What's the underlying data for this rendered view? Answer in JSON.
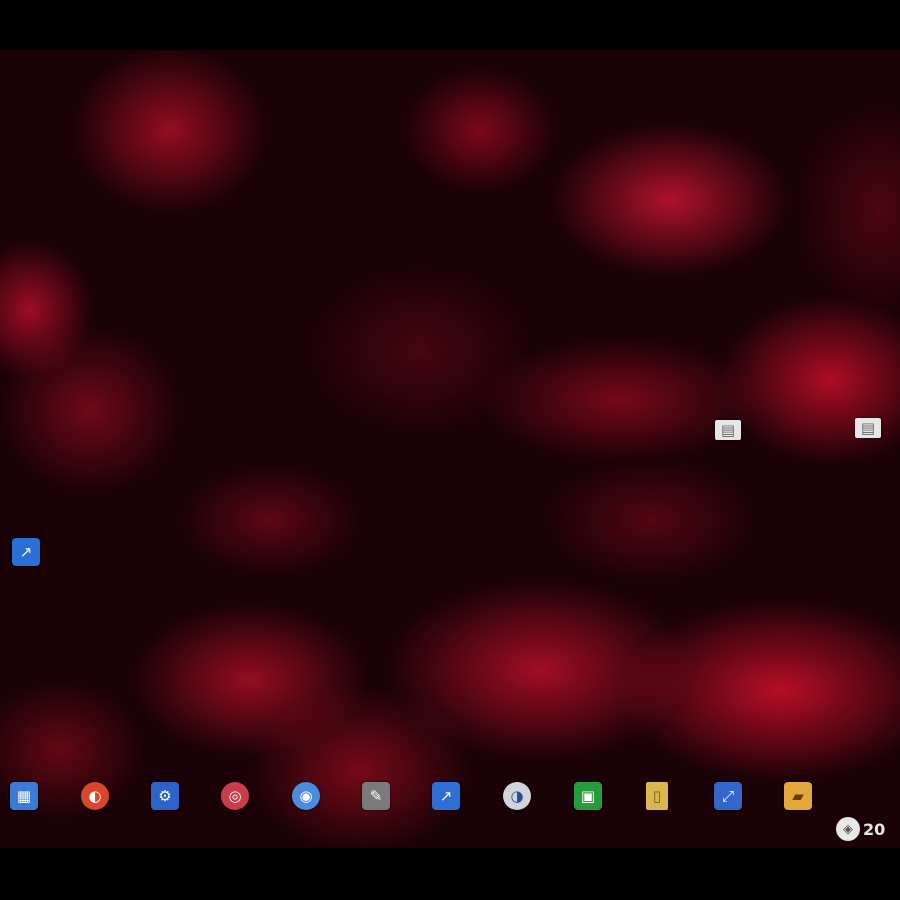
{
  "screen": {
    "colors": {
      "background": "#000000",
      "wallpaper_base": "#1a0206",
      "wallpaper_accent": "#c8102e",
      "icon_label": "#e9e9e9",
      "selection": "#2f4f9a"
    }
  },
  "desktop": {
    "top_icons": [
      {
        "label": "",
        "icon": "document-icon"
      },
      {
        "label": "",
        "icon": "document-icon"
      }
    ],
    "left_icon": {
      "label": "",
      "icon": "shortcut-icon"
    },
    "bottom_icons": [
      {
        "label": "",
        "icon": "app-icon"
      },
      {
        "label": "",
        "icon": "app-icon"
      },
      {
        "label": "",
        "icon": "app-icon"
      },
      {
        "label": "",
        "icon": "app-icon"
      },
      {
        "label": "",
        "icon": "app-icon"
      },
      {
        "label": "",
        "icon": "app-icon"
      },
      {
        "label": "",
        "icon": "app-icon"
      },
      {
        "label": "",
        "icon": "app-icon"
      },
      {
        "label": "",
        "icon": "app-icon"
      },
      {
        "label": "",
        "icon": "folder-icon"
      },
      {
        "label": "",
        "icon": "app-icon"
      },
      {
        "label": "",
        "icon": "folder-icon"
      }
    ],
    "tray": {
      "text": "20",
      "icon": "logo-icon"
    }
  }
}
